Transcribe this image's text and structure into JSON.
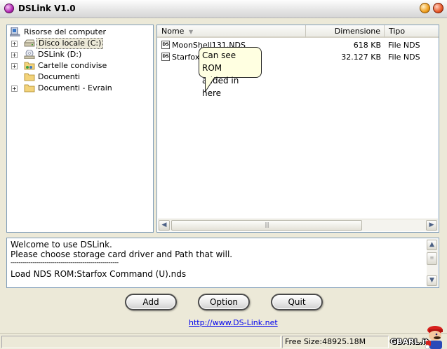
{
  "window": {
    "title": "DSLink V1.0"
  },
  "tree": {
    "root": "Risorse del computer",
    "items": [
      {
        "label": "Disco locale (C:)",
        "icon": "hard-drive-icon",
        "expander": "+",
        "selected": true
      },
      {
        "label": "DSLink (D:)",
        "icon": "cd-drive-icon",
        "expander": "+"
      },
      {
        "label": "Cartelle condivise",
        "icon": "shared-folder-icon",
        "expander": "+"
      },
      {
        "label": "Documenti",
        "icon": "folder-icon",
        "expander": ""
      },
      {
        "label": "Documenti - Evrain",
        "icon": "folder-icon",
        "expander": "+"
      }
    ]
  },
  "file_list": {
    "columns": [
      "Nome",
      "Dimensione",
      "Tipo"
    ],
    "rows": [
      {
        "name": "MoonShell131.NDS",
        "size": "618 KB",
        "type": "File NDS"
      },
      {
        "name": "Starfox C",
        "size": "32.127 KB",
        "type": "File NDS"
      }
    ],
    "scroll_grip": "|||"
  },
  "callout": {
    "line1": "Can see ROM",
    "line2": "added in here"
  },
  "log": {
    "lines": [
      "Welcome to use DSLink.",
      "Please choose storage card driver and Path that will.",
      "------------------------------------------------------",
      "Load NDS ROM:Starfox Command (U).nds"
    ]
  },
  "buttons": {
    "add": "Add",
    "option": "Option",
    "quit": "Quit"
  },
  "link": {
    "text": "http://www.DS-Link.net"
  },
  "status": {
    "free_size": "Free Size:48925.18M",
    "watermark": "GBARL.it"
  },
  "colors": {
    "accent": "#7f9db9",
    "callout_bg": "#ffffe1",
    "link": "#0000ee"
  }
}
